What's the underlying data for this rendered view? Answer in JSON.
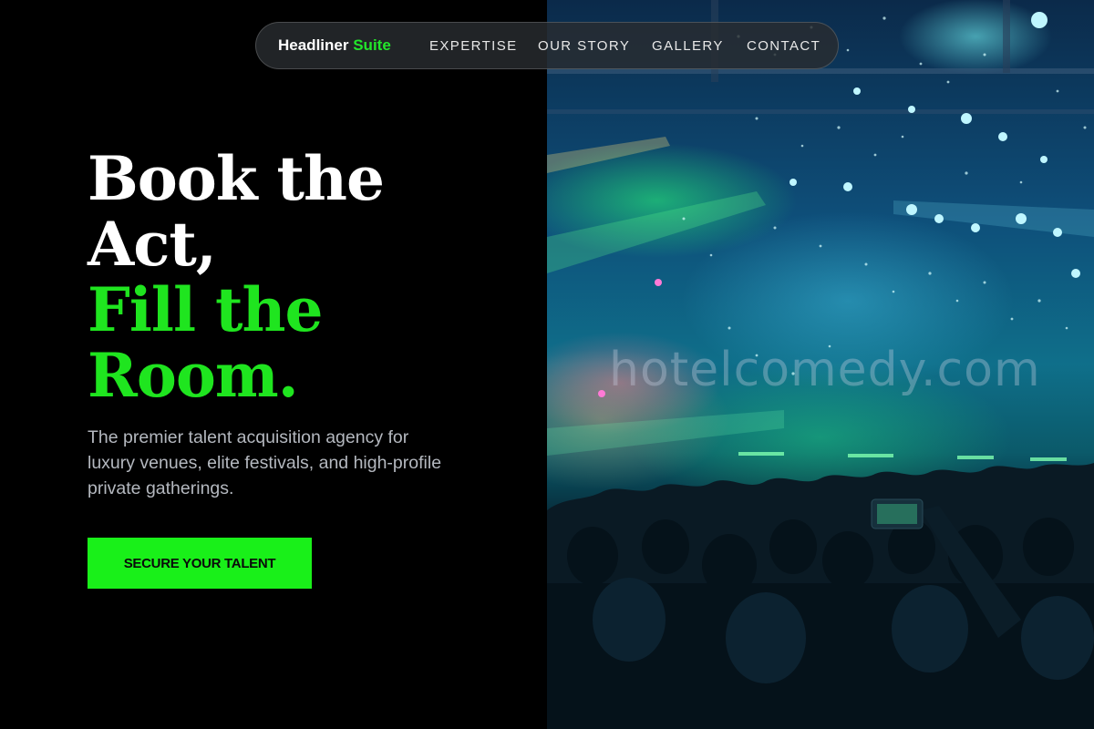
{
  "nav": {
    "brand_main": "Headliner",
    "brand_accent": "Suite",
    "links": [
      "EXPERTISE",
      "OUR STORY",
      "GALLERY",
      "CONTACT"
    ]
  },
  "hero": {
    "title_line1": "Book the",
    "title_line2": "Act,",
    "title_line3": "Fill the",
    "title_line4": "Room.",
    "description": "The premier talent acquisition agency for luxury venues, elite festivals, and high-profile private gatherings.",
    "cta_label": "SECURE YOUR TALENT"
  },
  "photo": {
    "watermark": "hotelcomedy.com"
  },
  "colors": {
    "background": "#000000",
    "accent_green": "#1fe51f",
    "button_green": "#19f019",
    "text_muted": "#b4b8bf",
    "nav_bg": "#282c30"
  }
}
